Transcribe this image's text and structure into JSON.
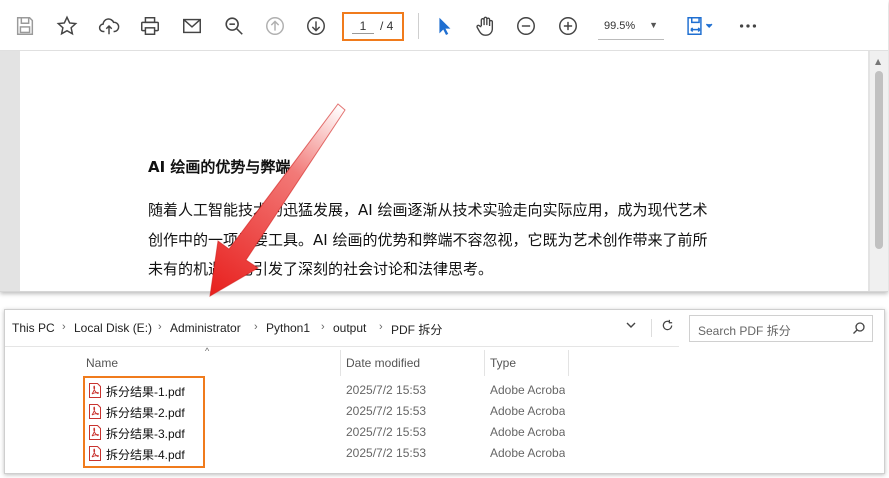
{
  "viewer": {
    "toolbar": {
      "page_current": "1",
      "page_total": "/ 4",
      "zoom": "99.5%"
    },
    "icons": {
      "save": "save-icon",
      "bookmark": "star-icon",
      "upload": "cloud-upload-icon",
      "print": "printer-icon",
      "email": "mail-icon",
      "zoom_search": "zoom-search-icon",
      "prev_page": "arrow-up-circle-icon",
      "next_page": "arrow-down-circle-icon",
      "select": "cursor-arrow-icon",
      "hand": "hand-icon",
      "zoom_out": "minus-circle-icon",
      "zoom_in": "plus-circle-icon",
      "fit": "fit-page-icon",
      "more": "more-icon"
    },
    "document": {
      "heading": "AI 绘画的优势与弊端",
      "lines": [
        "随着人工智能技术的迅猛发展，AI 绘画逐渐从技术实验走向实际应用，成为现代艺术",
        "创作中的一项重要工具。AI 绘画的优势和弊端不容忽视，它既为艺术创作带来了前所",
        "未有的机遇，也引发了深刻的社会讨论和法律思考。"
      ]
    }
  },
  "explorer": {
    "breadcrumb": [
      "This PC",
      "Local Disk (E:)",
      "Administrator",
      "Python1",
      "output",
      "PDF 拆分"
    ],
    "search_placeholder": "Search PDF 拆分",
    "columns": {
      "name": "Name",
      "date": "Date modified",
      "type": "Type"
    },
    "files": [
      {
        "name": "拆分结果-1.pdf",
        "date": "2025/7/2 15:53",
        "type": "Adobe Acrobat Document"
      },
      {
        "name": "拆分结果-2.pdf",
        "date": "2025/7/2 15:53",
        "type": "Adobe Acrobat Document"
      },
      {
        "name": "拆分结果-3.pdf",
        "date": "2025/7/2 15:53",
        "type": "Adobe Acrobat Document"
      },
      {
        "name": "拆分结果-4.pdf",
        "date": "2025/7/2 15:53",
        "type": "Adobe Acrobat Document"
      }
    ]
  },
  "colors": {
    "highlight_box": "#f07b1c",
    "arrow": "#e8201e",
    "accent_blue": "#1f6fd1"
  }
}
